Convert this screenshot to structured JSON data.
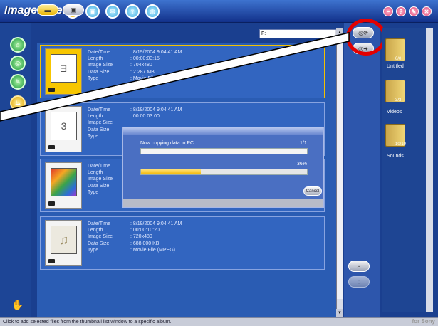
{
  "app": {
    "title": "ImageMixer",
    "brand": "for Sony"
  },
  "titlebar": {
    "top_icons": [
      "cd-icon",
      "camera-icon",
      "mail-icon",
      "upload-icon",
      "globe-icon"
    ],
    "window_buttons": [
      {
        "name": "minimize",
        "glyph": "–"
      },
      {
        "name": "help",
        "glyph": "?"
      },
      {
        "name": "tools",
        "glyph": "✎"
      },
      {
        "name": "close",
        "glyph": "✕"
      }
    ]
  },
  "path": {
    "value": "F:"
  },
  "items": [
    {
      "thumb": "Ǝ",
      "labels": [
        "Date/Time",
        "Length",
        "Image Size",
        "Data Size",
        "Type"
      ],
      "values": [
        ":   8/19/2004 9:04:41 AM",
        ":   00:00:03:15",
        ":   704x480",
        ":   2.287 MB",
        ":   Movie File ..."
      ]
    },
    {
      "thumb": "3",
      "labels": [
        "Date/Time",
        "Length",
        "Image Size",
        "Data Size",
        "Type"
      ],
      "values": [
        ":   8/19/2004 9:04:41 AM",
        ":   00:00:03:00",
        "",
        "",
        ""
      ]
    },
    {
      "thumb": "",
      "labels": [
        "Date/Time",
        "Length",
        "Image Size",
        "Data Size",
        "Type"
      ],
      "values": [
        "",
        "",
        "",
        "",
        ""
      ]
    },
    {
      "thumb": "♫",
      "labels": [
        "Date/Time",
        "Length",
        "Image Size",
        "Data Size",
        "Type"
      ],
      "values": [
        ":   8/19/2004 9:04:41 AM",
        ":   00:00:10:20",
        ":   720x480",
        ":   688.000 KB",
        ":   Movie File (MPEG)"
      ]
    }
  ],
  "dialog": {
    "message": "Now copying data to PC.",
    "count": "1/1",
    "percent": "36%",
    "progress": 0.36,
    "cancel": "Cancel"
  },
  "albums": [
    {
      "name": "Untitled",
      "count": "0/0"
    },
    {
      "name": "Videos",
      "count": "3/3"
    },
    {
      "name": "Sounds",
      "count": "10/10"
    }
  ],
  "status": {
    "text": "Click to add selected files from the thumbnail list window to a specific album."
  }
}
